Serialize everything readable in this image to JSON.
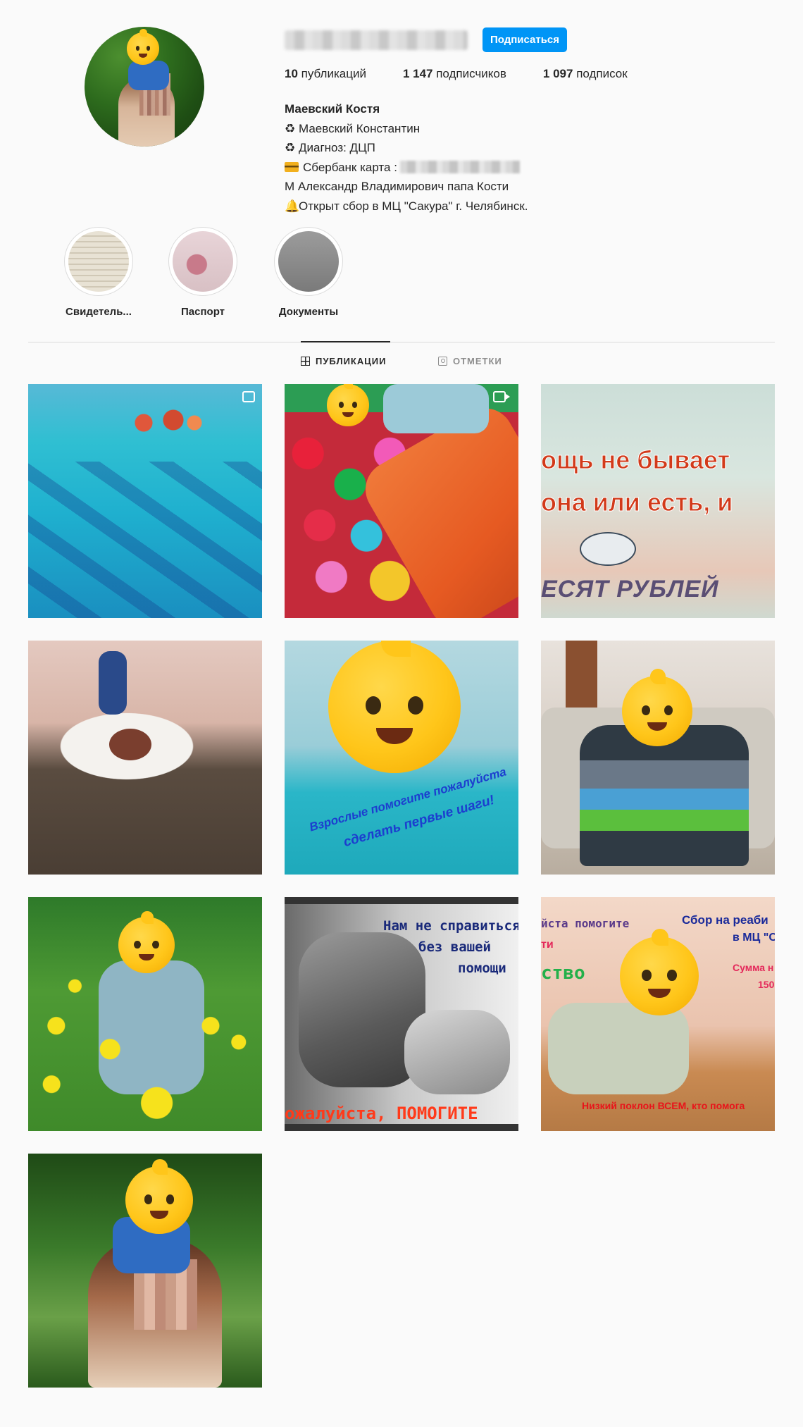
{
  "profile": {
    "follow_label": "Подписаться",
    "stats": [
      {
        "count": "10",
        "label": "публикаций"
      },
      {
        "count": "1 147",
        "label": "подписчиков"
      },
      {
        "count": "1 097",
        "label": "подписок"
      }
    ],
    "bio": {
      "name": "Маевский Костя",
      "line1_icon": "recycle-icon",
      "line1_text": "Маевский Константин",
      "line2_text": "Диагноз: ДЦП",
      "line3_text": "Сбербанк карта :",
      "line4_text": "М Александр Владимирович папа Кости",
      "line5_text": "Открыт сбор в МЦ \"Сакура\" г. Челябинск."
    }
  },
  "highlights": [
    {
      "label": "Свидетель..."
    },
    {
      "label": "Паспорт"
    },
    {
      "label": "Документы"
    }
  ],
  "tabs": {
    "posts": "ПУБЛИКАЦИИ",
    "tagged": "ОТМЕТКИ"
  },
  "posts": {
    "p3": {
      "line1": "ощь не бывает",
      "line2": "она или есть, и",
      "line3": "ЕСЯТ РУБЛЕЙ"
    },
    "p5": {
      "line1": "Взрослые помогите пожалуйста",
      "line2": "сделать первые шаги!"
    },
    "p8": {
      "line1": "Нам не справиться",
      "line2": "без вашей",
      "line3": "помощи",
      "line4": "ожалуйста, ПОМОГИТЕ"
    },
    "p9": {
      "line1": "йста помогите",
      "line2": "Сбор на реаби",
      "line3": "в МЦ \"СА",
      "line4": "ти",
      "line5": "ство",
      "line6": "Сумма н",
      "line7": "150",
      "line8": "Низкий поклон ВСЕМ, кто помога"
    }
  },
  "colors": {
    "accent": "#0095f6",
    "text": "#262626",
    "muted": "#8e8e8e",
    "divider": "#dbdbdb"
  }
}
